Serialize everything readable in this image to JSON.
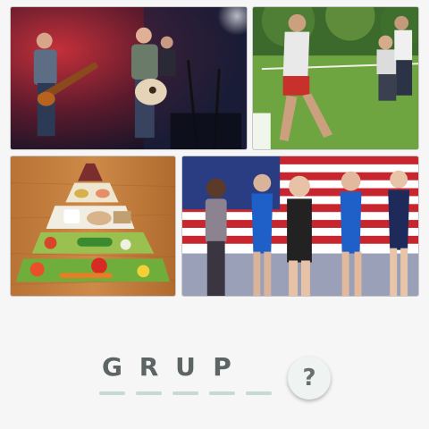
{
  "images": [
    {
      "name": "concert-band-photo"
    },
    {
      "name": "tug-of-war-photo"
    },
    {
      "name": "food-pyramid-photo"
    },
    {
      "name": "gymnastics-team-photo"
    }
  ],
  "answer": {
    "letters": [
      "G",
      "R",
      "U",
      "P",
      ""
    ],
    "total_slots": 5
  },
  "hint_button": {
    "icon": "question-mark-icon",
    "symbol": "?"
  },
  "colors": {
    "background": "#f6f6f6",
    "letter": "#5d6464",
    "slot_line": "#c6d9d4",
    "hint_bubble": "#eff4f3"
  }
}
